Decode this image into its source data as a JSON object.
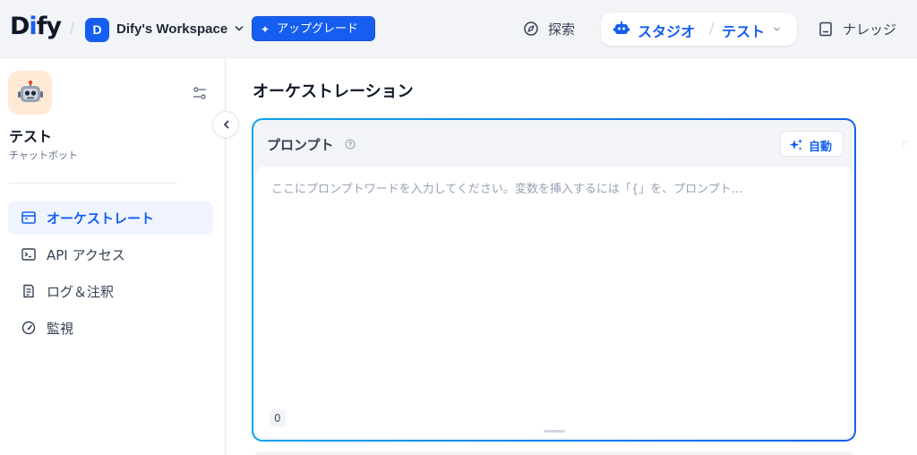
{
  "header": {
    "logo": {
      "pre": "D",
      "accent": "i",
      "post": "fy"
    },
    "separator": "/",
    "workspace": {
      "initial": "D",
      "name": "Dify's Workspace"
    },
    "upgrade_label": "アップグレード",
    "nav": {
      "explore_label": "探索",
      "studio_label": "スタジオ",
      "app_separator": "/",
      "current_app": "テスト",
      "knowledge_label": "ナレッジ"
    }
  },
  "sidebar": {
    "app_name": "テスト",
    "app_type": "チャットボット",
    "app_icon": "robot-emoji",
    "items": [
      {
        "label": "オーケストレート",
        "icon": "window-icon",
        "active": true
      },
      {
        "label": "API アクセス",
        "icon": "terminal-icon",
        "active": false
      },
      {
        "label": "ログ＆注釈",
        "icon": "file-list-icon",
        "active": false
      },
      {
        "label": "監視",
        "icon": "dashboard-gauge-icon",
        "active": false
      }
    ]
  },
  "main": {
    "title": "オーケストレーション",
    "prompt": {
      "label": "プロンプト",
      "auto_label": "自動",
      "placeholder": "ここにプロンプトワードを入力してください。変数を挿入するには「{」を、プロンプト...",
      "char_count": "0"
    }
  },
  "colors": {
    "accent": "#155eef",
    "accent_light": "#eff4ff",
    "prompt_border_start": "#0ba5ec",
    "prompt_border_end": "#155eef",
    "app_icon_bg": "#ffead5"
  }
}
